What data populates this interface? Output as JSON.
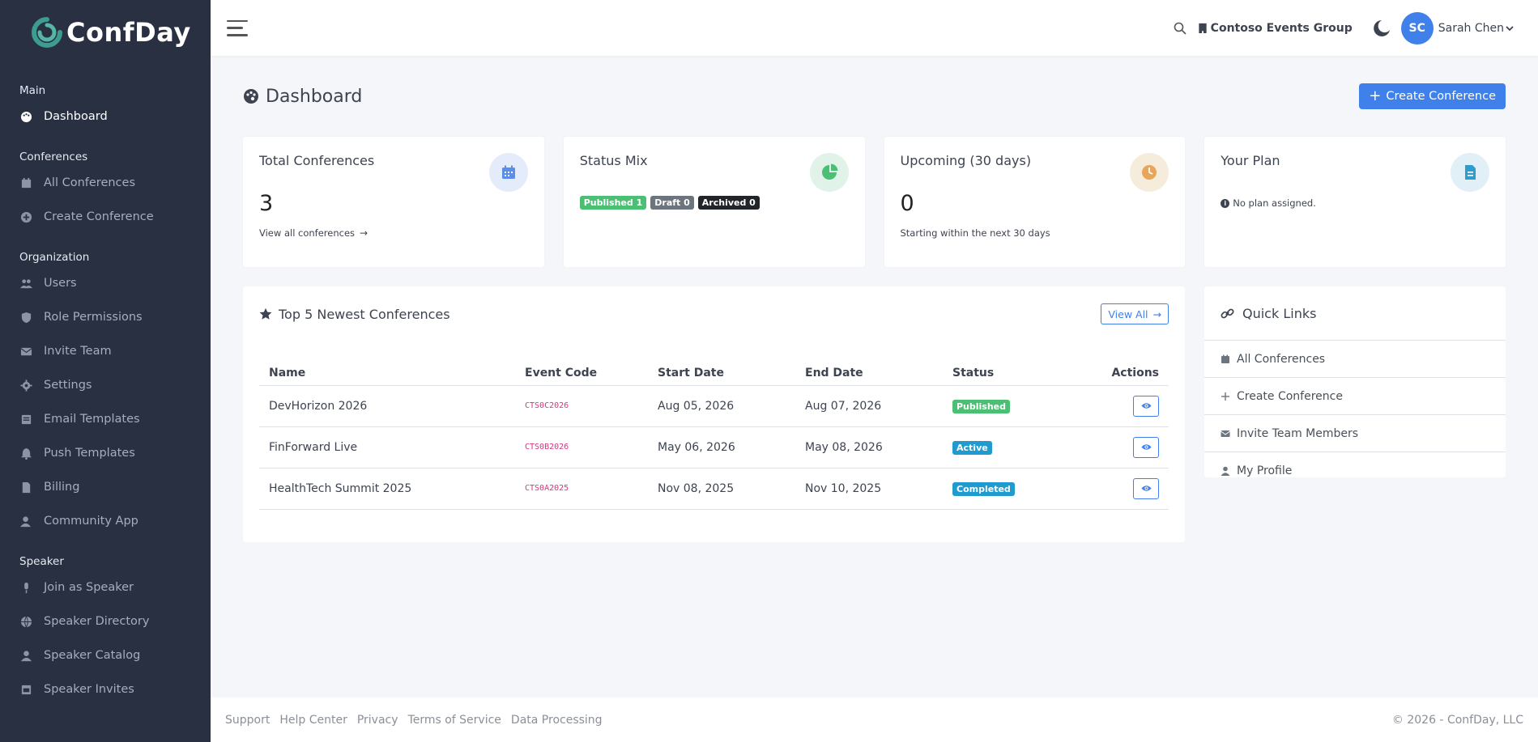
{
  "brand": {
    "name": "ConfDay"
  },
  "sidebar": {
    "sections": [
      {
        "title": "Main",
        "items": [
          {
            "label": "Dashboard",
            "icon": "palette-icon",
            "active": true
          }
        ]
      },
      {
        "title": "Conferences",
        "items": [
          {
            "label": "All Conferences",
            "icon": "calendar-icon"
          },
          {
            "label": "Create Conference",
            "icon": "plus-circle-icon"
          }
        ]
      },
      {
        "title": "Organization",
        "items": [
          {
            "label": "Users",
            "icon": "users-icon"
          },
          {
            "label": "Role Permissions",
            "icon": "shield-icon"
          },
          {
            "label": "Invite Team",
            "icon": "envelope-icon"
          },
          {
            "label": "Settings",
            "icon": "gear-icon"
          },
          {
            "label": "Email Templates",
            "icon": "mail-template-icon"
          },
          {
            "label": "Push Templates",
            "icon": "bell-icon"
          },
          {
            "label": "Billing",
            "icon": "document-icon"
          },
          {
            "label": "Community App",
            "icon": "user-app-icon"
          }
        ]
      },
      {
        "title": "Speaker",
        "items": [
          {
            "label": "Join as Speaker",
            "icon": "microphone-icon"
          },
          {
            "label": "Speaker Directory",
            "icon": "globe-icon"
          },
          {
            "label": "Speaker Catalog",
            "icon": "user-icon"
          },
          {
            "label": "Speaker Invites",
            "icon": "invite-icon"
          }
        ]
      }
    ]
  },
  "topbar": {
    "org_name": "Contoso Events Group",
    "user_initials": "SC",
    "user_name": "Sarah Chen"
  },
  "page": {
    "title": "Dashboard",
    "create_button": "Create Conference"
  },
  "cards": {
    "total": {
      "title": "Total Conferences",
      "value": "3",
      "link": "View all conferences"
    },
    "status": {
      "title": "Status Mix",
      "badges": [
        "Published 1",
        "Draft 0",
        "Archived 0"
      ]
    },
    "upcoming": {
      "title": "Upcoming (30 days)",
      "value": "0",
      "note": "Starting within the next 30 days"
    },
    "plan": {
      "title": "Your Plan",
      "note": "No plan assigned."
    }
  },
  "newest": {
    "title": "Top 5 Newest Conferences",
    "view_all": "View All",
    "columns": [
      "Name",
      "Event Code",
      "Start Date",
      "End Date",
      "Status",
      "Actions"
    ],
    "rows": [
      {
        "name": "DevHorizon 2026",
        "code": "CTS0C2026",
        "start": "Aug 05, 2026",
        "end": "Aug 07, 2026",
        "status": "Published",
        "status_color": "#4bbf73"
      },
      {
        "name": "FinForward Live",
        "code": "CTS0B2026",
        "start": "May 06, 2026",
        "end": "May 08, 2026",
        "status": "Active",
        "status_color": "#1f9bcf"
      },
      {
        "name": "HealthTech Summit 2025",
        "code": "CTS0A2025",
        "start": "Nov 08, 2025",
        "end": "Nov 10, 2025",
        "status": "Completed",
        "status_color": "#1f9bcf"
      }
    ]
  },
  "quick_links": {
    "title": "Quick Links",
    "items": [
      {
        "label": "All Conferences",
        "icon": "calendar-icon"
      },
      {
        "label": "Create Conference",
        "icon": "plus-icon"
      },
      {
        "label": "Invite Team Members",
        "icon": "envelope-icon"
      },
      {
        "label": "My Profile",
        "icon": "user-icon"
      }
    ]
  },
  "footer": {
    "links": [
      "Support",
      "Help Center",
      "Privacy",
      "Terms of Service",
      "Data Processing"
    ],
    "copyright": "© 2026 - ConfDay, LLC"
  },
  "colors": {
    "sidebar": "#293042",
    "accent": "#3f80ea",
    "success": "#4bbf73",
    "info": "#1f9bcf"
  }
}
